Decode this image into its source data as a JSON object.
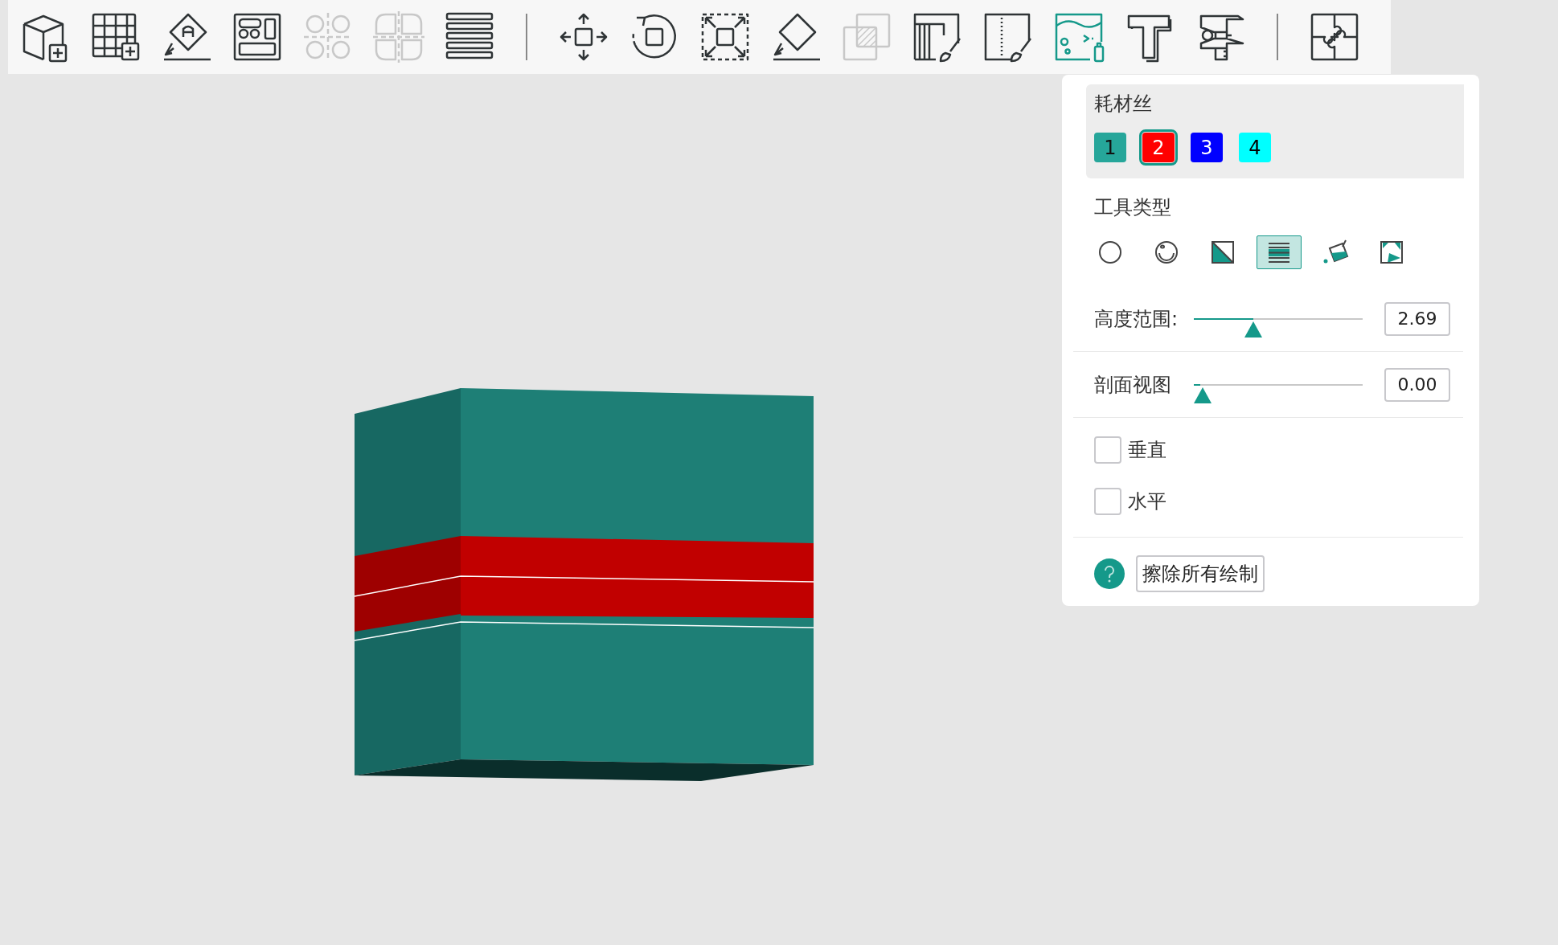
{
  "toolbar": {
    "tools": [
      {
        "kind": "add-model",
        "disabled": false
      },
      {
        "kind": "add-grid",
        "disabled": false
      },
      {
        "kind": "place-face",
        "disabled": false
      },
      {
        "kind": "arrange",
        "disabled": false
      },
      {
        "kind": "split-objects",
        "disabled": true
      },
      {
        "kind": "split-parts",
        "disabled": true
      },
      {
        "kind": "layers",
        "disabled": false
      },
      {
        "kind": "separator",
        "disabled": false
      },
      {
        "kind": "move",
        "disabled": false
      },
      {
        "kind": "rotate",
        "disabled": false
      },
      {
        "kind": "scale",
        "disabled": false
      },
      {
        "kind": "lay-flat",
        "disabled": false
      },
      {
        "kind": "boolean",
        "disabled": true
      },
      {
        "kind": "support-paint",
        "disabled": false
      },
      {
        "kind": "seam-paint",
        "disabled": false
      },
      {
        "kind": "color-paint",
        "disabled": false
      },
      {
        "kind": "text",
        "disabled": false
      },
      {
        "kind": "measure",
        "disabled": false
      },
      {
        "kind": "separator",
        "disabled": false
      },
      {
        "kind": "assemble",
        "disabled": false
      }
    ]
  },
  "panel": {
    "filament": {
      "title": "耗材丝",
      "swatches": [
        {
          "label": "1",
          "color": "#26a69a",
          "selected": false
        },
        {
          "label": "2",
          "color": "#ff0000",
          "selected": true
        },
        {
          "label": "3",
          "color": "#0000ff",
          "selected": false
        },
        {
          "label": "4",
          "color": "#00ffff",
          "selected": false
        }
      ]
    },
    "tool_type": {
      "title": "工具类型",
      "tools": [
        {
          "kind": "circle",
          "selected": false
        },
        {
          "kind": "sphere",
          "selected": false
        },
        {
          "kind": "triangle",
          "selected": false
        },
        {
          "kind": "height-range",
          "selected": true
        },
        {
          "kind": "fill",
          "selected": false
        },
        {
          "kind": "gap-fill",
          "selected": false
        }
      ]
    },
    "sliders": [
      {
        "label": "高度范围:",
        "level": 0.35,
        "value": "2.69"
      },
      {
        "label": "剖面视图",
        "level": 0,
        "value": "0.00"
      }
    ],
    "checkboxes": [
      {
        "label": "垂直",
        "checked": false
      },
      {
        "label": "水平",
        "checked": false
      }
    ],
    "erase_button": "擦除所有绘制"
  }
}
